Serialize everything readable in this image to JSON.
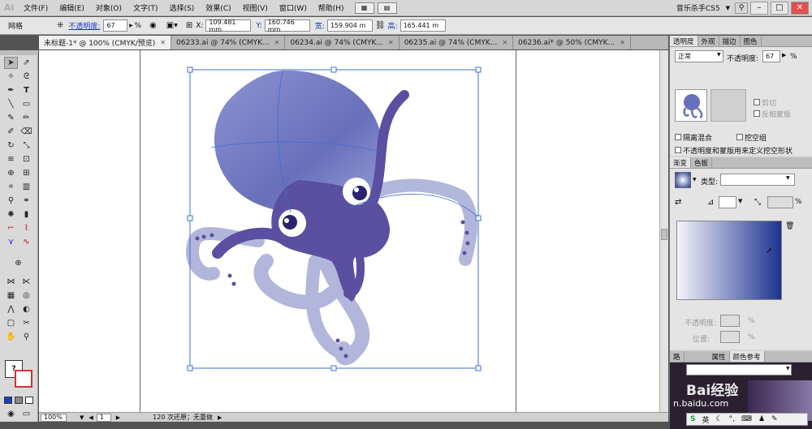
{
  "app": {
    "logo": "Ai",
    "menus": [
      "文件(F)",
      "编辑(E)",
      "对象(O)",
      "文字(T)",
      "选择(S)",
      "效果(C)",
      "视图(V)",
      "窗口(W)",
      "帮助(H)"
    ],
    "workspace": "音乐杀手CS5",
    "window_controls": [
      "–",
      "□",
      "✕"
    ]
  },
  "control_bar": {
    "label": "网格",
    "opacity_label": "不透明度:",
    "opacity_value": "67",
    "opacity_unit": "%",
    "x_label": "X:",
    "x_value": "109.481 mm",
    "y_label": "Y:",
    "y_value": "160.746 mm",
    "w_label": "宽:",
    "w_value": "159.904 m",
    "h_label": "高:",
    "h_value": "165.441 m"
  },
  "doc_tabs": [
    {
      "label": "未标题-1* @ 100% (CMYK/预览)",
      "active": true
    },
    {
      "label": "06233.ai @ 74% (CMYK...",
      "active": false
    },
    {
      "label": "06234.ai @ 74% (CMYK...",
      "active": false
    },
    {
      "label": "06235.ai @ 74% (CMYK...",
      "active": false
    },
    {
      "label": "06236.ai* @ 50% (CMYK...",
      "active": false
    }
  ],
  "status": {
    "zoom": "100%",
    "page": "1",
    "history": "120 次还原；无重做"
  },
  "transparency_panel": {
    "tabs": [
      "透明度",
      "外观",
      "描边",
      "图色"
    ],
    "blend_mode": "正常",
    "opacity_label": "不透明度:",
    "opacity_value": "67",
    "opacity_unit": "%",
    "clip_label": "剪切",
    "invert_mask_label": "反相蒙版",
    "isolate_blend_label": "隔离混合",
    "knockout_label": "挖空组",
    "opacity_mask_label": "不透明度和蒙版用来定义挖空形状"
  },
  "gradient_panel": {
    "tabs": [
      "渐变",
      "色板"
    ],
    "type_label": "类型:",
    "opacity_label": "不透明度:",
    "location_label": "位置:",
    "percent": "%",
    "start_color": "#f4f4fa",
    "end_color": "#1e3490"
  },
  "bottom_panel": {
    "tabs": [
      "路",
      "属性",
      "颜色参考"
    ],
    "watermark": "Bai经验",
    "watermark_url": "n.baidu.com",
    "ime_label": "英"
  },
  "colors": {
    "octopus_head": "#6f74bf",
    "octopus_body": "#5a4fa0",
    "tentacle_light": "#b3b6db",
    "selection": "#3a6fd9"
  }
}
